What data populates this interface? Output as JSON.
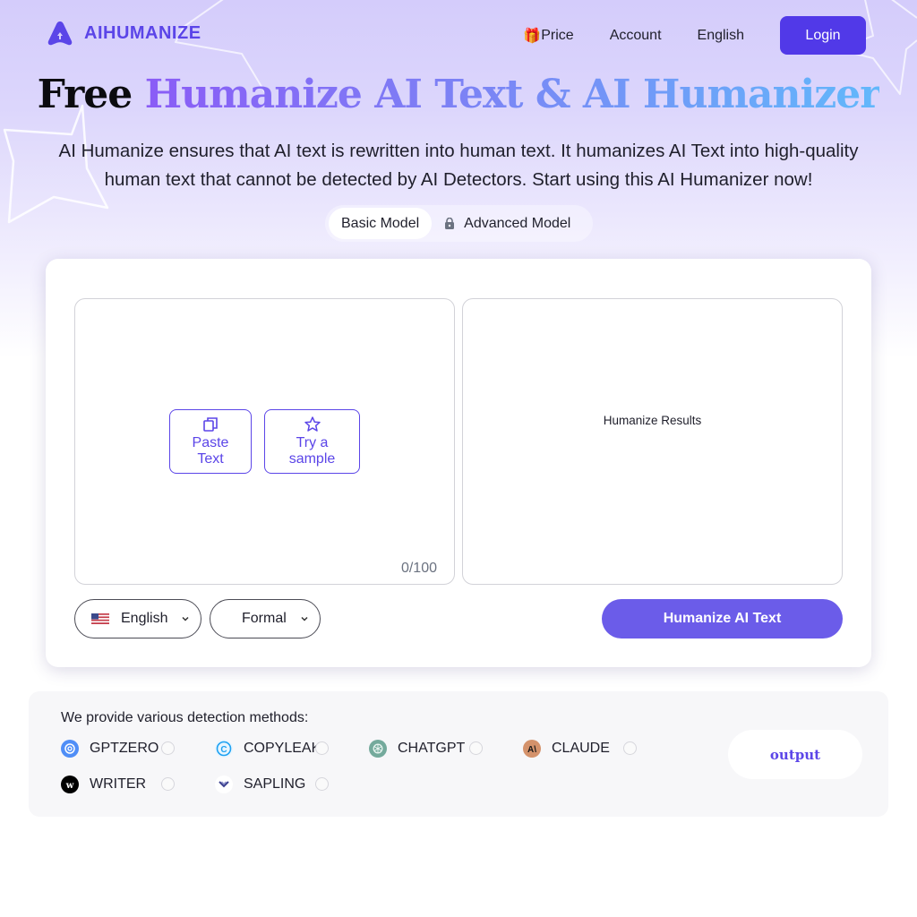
{
  "header": {
    "brand": "AIHUMANIZE",
    "nav": {
      "price_icon": "🎁",
      "price": "Price",
      "account": "Account",
      "language": "English",
      "login": "Login"
    }
  },
  "hero": {
    "title_plain": "Free",
    "title_highlight": "Humanize AI Text & AI Humanizer",
    "subtitle_line1": "AI Humanize ensures that AI text is rewritten into human text. It humanizes AI Text into high-quality",
    "subtitle_line2": "human text that cannot be detected by AI Detectors. Start using this AI Humanizer now!"
  },
  "model_tabs": [
    {
      "label": "Basic Model",
      "active": true,
      "locked": false
    },
    {
      "label": "Advanced Model",
      "active": false,
      "locked": true
    }
  ],
  "editor": {
    "paste_line1": "Paste",
    "paste_line2": "Text",
    "sample_line1": "Try a",
    "sample_line2": "sample",
    "counter": "0/100",
    "results_placeholder": "Humanize Results",
    "language_select": "English",
    "tone_select": "Formal",
    "humanize_button": "Humanize AI Text"
  },
  "detection": {
    "title": "We provide various detection methods:",
    "methods": [
      {
        "name": "GPTZERO",
        "icon": "gptzero-icon",
        "color": "#4f8ef7",
        "selected": false
      },
      {
        "name": "COPYLEAK",
        "icon": "copyleaks-icon",
        "color": "#1da1f2",
        "selected": false
      },
      {
        "name": "CHATGPT",
        "icon": "chatgpt-icon",
        "color": "#74aa9c",
        "selected": false
      },
      {
        "name": "CLAUDE",
        "icon": "claude-icon",
        "color": "#d4926b",
        "selected": false
      },
      {
        "name": "WRITER",
        "icon": "writer-icon",
        "color": "#000000",
        "selected": false
      },
      {
        "name": "SAPLING",
        "icon": "sapling-icon",
        "color": "#3b3f8f",
        "selected": false
      }
    ],
    "output_button": "output"
  },
  "colors": {
    "brand": "#5139e8",
    "accent": "#6b5ce9"
  }
}
